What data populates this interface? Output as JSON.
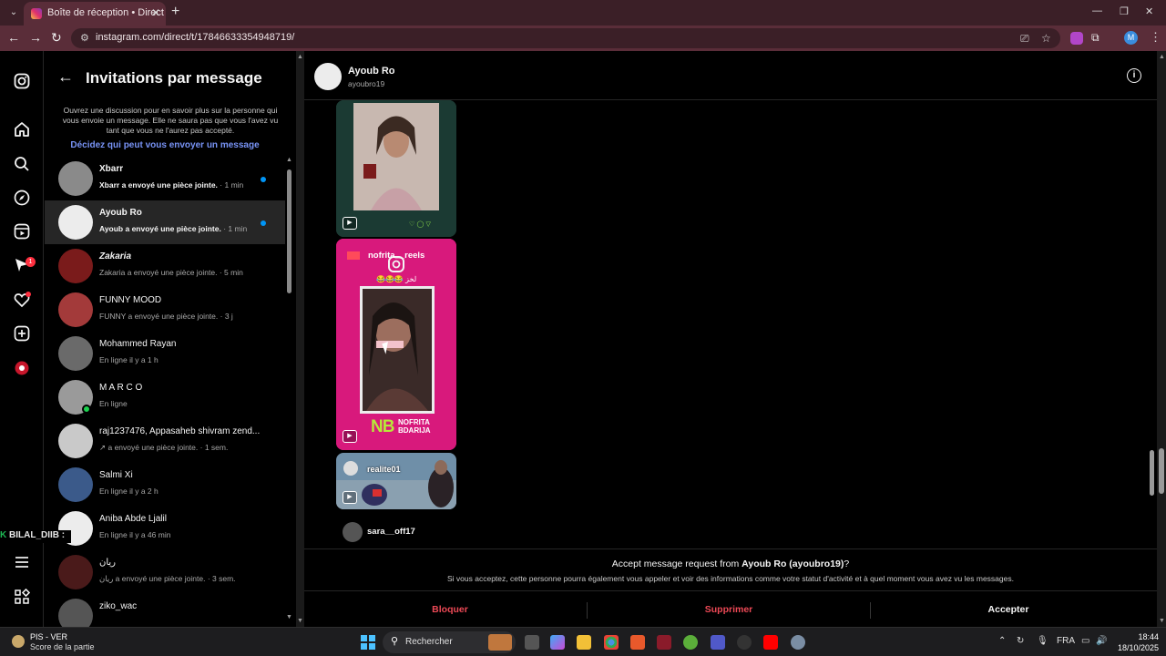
{
  "browser": {
    "tab_title": "Boîte de réception • Direct",
    "url": "instagram.com/direct/t/17846633354948719/",
    "profile_initial": "M"
  },
  "overlay": {
    "prefix": "K",
    "text": " BILAL_DIIB :"
  },
  "rail": {
    "icons": [
      "instagram-icon",
      "home-icon",
      "search-icon",
      "explore-icon",
      "reels-icon",
      "messages-icon",
      "notifications-icon",
      "create-icon",
      "profile-icon",
      "menu-icon",
      "apps-icon"
    ],
    "messages_badge": "1"
  },
  "requests": {
    "title": "Invitations par message",
    "description": "Ouvrez une discussion pour en savoir plus sur la personne qui vous envoie un message. Elle ne saura pas que vous l'avez vu tant que vous ne l'aurez pas accepté.",
    "settings_link": "Décidez qui peut vous envoyer un message",
    "items": [
      {
        "name": "Xbarr",
        "sub": "Xbarr a envoyé une pièce jointe.",
        "time": " · 1 min",
        "unread": true
      },
      {
        "name": "Ayoub Ro",
        "sub": "Ayoub a envoyé une pièce jointe.",
        "time": " · 1 min",
        "unread": true,
        "active": true
      },
      {
        "name": "Zakaria",
        "sub": "Zakaria a envoyé une pièce jointe.",
        "time": " · 5 min"
      },
      {
        "name": "FUNNY MOOD",
        "sub": "FUNNY a envoyé une pièce jointe.",
        "time": " · 3 j"
      },
      {
        "name": "Mohammed Rayan",
        "sub": "En ligne il y a 1 h",
        "time": ""
      },
      {
        "name": "M A R C O",
        "sub": "En ligne",
        "time": "",
        "online": true
      },
      {
        "name": "raj1237476, Appasaheb shivram zend...",
        "sub": "↗ a envoyé une pièce jointe.",
        "time": " · 1 sem."
      },
      {
        "name": "Salmi Xi",
        "sub": "En ligne il y a 2 h",
        "time": ""
      },
      {
        "name": "Aniba Abde Ljalil",
        "sub": "En ligne il y a 46 min",
        "time": ""
      },
      {
        "name": "ريان",
        "sub": "ريان a envoyé une pièce jointe.",
        "time": " · 3 sem."
      },
      {
        "name": "ziko_wac",
        "sub": "",
        "time": ""
      }
    ]
  },
  "chat": {
    "name": "Ayoub Ro",
    "username": "ayoubro19",
    "reel_user_1": "nofrita__reels",
    "reel_emoji": "😂😂😂 لخز",
    "reel_brand": "NB",
    "reel_brand_sub": "NOFRITA\nBDARIJA",
    "reel_user_2": "realite01",
    "sender": "sara__off17"
  },
  "accept": {
    "question_prefix": "Accept message request from ",
    "question_name": "Ayoub Ro (ayoubro19)",
    "question_suffix": "?",
    "info": "Si vous acceptez, cette personne pourra également vous appeler et voir des informations comme votre statut d'activité et à quel moment vous avez vu les messages.",
    "block": "Bloquer",
    "delete": "Supprimer",
    "accept": "Accepter"
  },
  "taskbar": {
    "weather_1": "PIS - VER",
    "weather_2": "Score de la partie",
    "search": "Rechercher",
    "lang": "FRA",
    "time": "18:44",
    "date": "18/10/2025"
  }
}
